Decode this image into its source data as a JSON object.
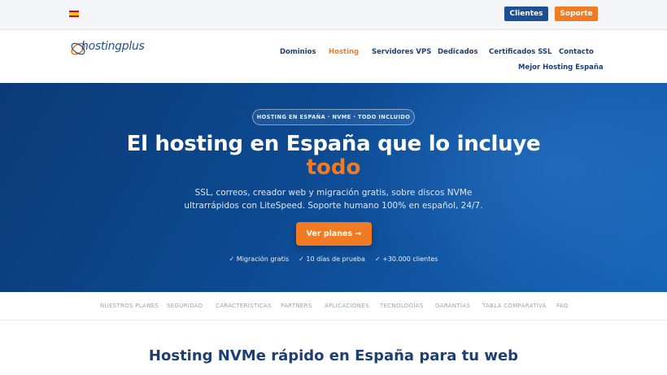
{
  "topbar": {
    "flag_icon": "spain-flag-icon",
    "clientes_label": "Clientes",
    "soporte_label": "Soporte",
    "colors": {
      "clientes": "#1d4f95",
      "soporte": "#f07b22"
    }
  },
  "header": {
    "logo_text": "hostingplus",
    "nav": [
      {
        "label": "Dominios",
        "active": false
      },
      {
        "label": "Hosting",
        "active": true
      },
      {
        "label": "Servidores VPS",
        "active": false
      },
      {
        "label": "Dedicados",
        "active": false
      },
      {
        "label": "Certificados SSL",
        "active": false
      },
      {
        "label": "Contacto",
        "active": false
      },
      {
        "label": "Mejor Hosting España",
        "active": false
      }
    ]
  },
  "hero": {
    "pill": "HOSTING EN ESPAÑA · NVME · TODO INCLUIDO",
    "title": "El hosting en España que lo incluye",
    "title_highlight": "todo",
    "subtitle": "SSL, correos, creador web y migración gratis, sobre discos NVMe ultrarrápidos con LiteSpeed. Soporte humano 100% en español, 24/7.",
    "cta_label": "Ver planes →",
    "checks": [
      "✓ Migración gratis",
      "✓ 10 días de prueba",
      "✓ +30.000 clientes"
    ],
    "colors": {
      "accent": "#f07b22",
      "background": "#0d4a92"
    }
  },
  "subnav": {
    "items": [
      "NUESTROS PLANES",
      "SEGURIDAD",
      "CARACTERÍSTICAS",
      "PARTNERS",
      "APLICACIONES",
      "TECNOLOGÍAS",
      "GARANTÍAS",
      "TABLA COMPARATIVA",
      "FAQ"
    ]
  },
  "section": {
    "title": "Hosting NVMe rápido en España para tu web"
  }
}
